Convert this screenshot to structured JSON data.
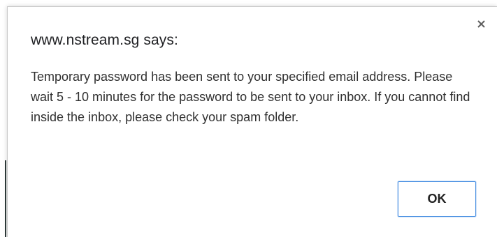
{
  "dialog": {
    "title": "www.nstream.sg says:",
    "message": "Temporary password has been sent to your specified email address. Please wait 5 - 10 minutes for the password to be sent to your inbox. If you cannot find inside the inbox, please check your spam folder.",
    "ok_label": "OK",
    "close_icon": "close-icon"
  },
  "colors": {
    "accent": "#4a90e2",
    "text": "#303030",
    "background": "#ffffff"
  }
}
